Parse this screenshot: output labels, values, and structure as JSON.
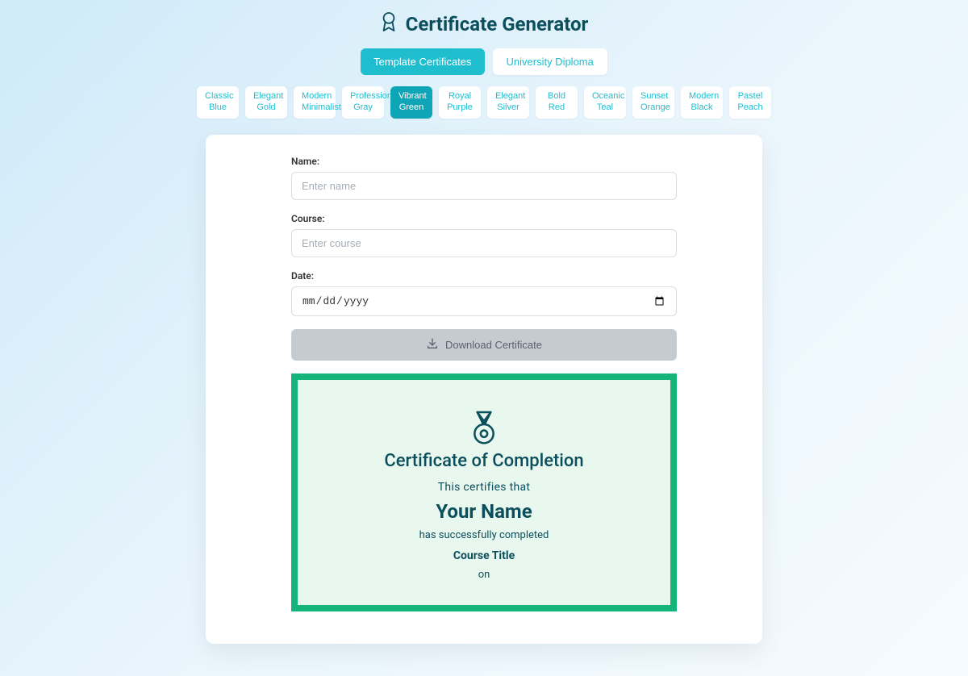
{
  "header": {
    "title": "Certificate Generator"
  },
  "tabs": {
    "template_certificates": "Template Certificates",
    "university_diploma": "University Diploma"
  },
  "templates": [
    "Classic Blue",
    "Elegant Gold",
    "Modern Minimalist",
    "Professional Gray",
    "Vibrant Green",
    "Royal Purple",
    "Elegant Silver",
    "Bold Red",
    "Oceanic Teal",
    "Sunset Orange",
    "Modern Black",
    "Pastel Peach"
  ],
  "active_template_index": 4,
  "form": {
    "name_label": "Name:",
    "name_placeholder": "Enter name",
    "course_label": "Course:",
    "course_placeholder": "Enter course",
    "date_label": "Date:",
    "date_placeholder": "mm/dd/yyyy",
    "download_label": "Download Certificate"
  },
  "preview": {
    "heading": "Certificate of Completion",
    "certifies": "This certifies that",
    "recipient": "Your Name",
    "completed_line": "has successfully completed",
    "course": "Course Title",
    "on": "on"
  }
}
